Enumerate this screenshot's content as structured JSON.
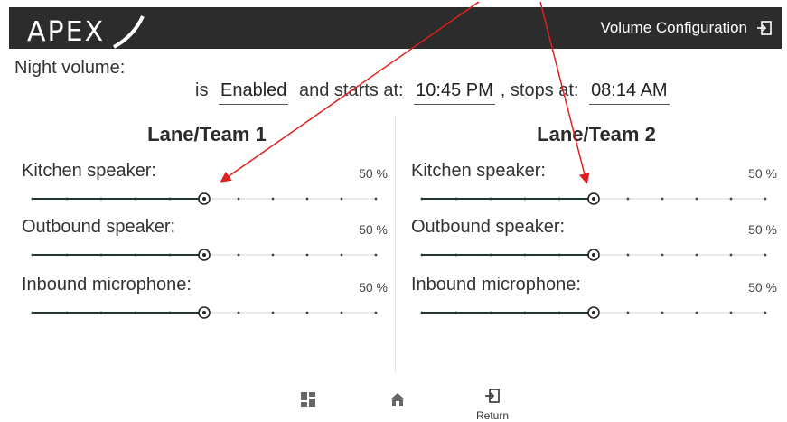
{
  "header": {
    "logo_text": "APEX",
    "title": "Volume Configuration",
    "exit_icon": "logout-icon"
  },
  "night_volume": {
    "label": "Night volume:",
    "prefix": "is",
    "state": "Enabled",
    "starts_label": "and starts at:",
    "start_time": "10:45 PM",
    "stops_label": ", stops at:",
    "stop_time": "08:14 AM"
  },
  "lanes": [
    {
      "title": "Lane/Team 1",
      "controls": [
        {
          "label": "Kitchen speaker:",
          "percent_text": "50 %",
          "value": 50
        },
        {
          "label": "Outbound speaker:",
          "percent_text": "50 %",
          "value": 50
        },
        {
          "label": "Inbound microphone:",
          "percent_text": "50 %",
          "value": 50
        }
      ]
    },
    {
      "title": "Lane/Team 2",
      "controls": [
        {
          "label": "Kitchen speaker:",
          "percent_text": "50 %",
          "value": 50
        },
        {
          "label": "Outbound speaker:",
          "percent_text": "50 %",
          "value": 50
        },
        {
          "label": "Inbound microphone:",
          "percent_text": "50 %",
          "value": 50
        }
      ]
    }
  ],
  "bottom_nav": {
    "grid_icon": "dashboard-icon",
    "home_icon": "home-icon",
    "return_icon": "return-icon",
    "return_label": "Return"
  },
  "colors": {
    "header_bg": "#2c2c2c",
    "slider_active": "#1f3a2a",
    "annotation_arrow": "#e02020"
  }
}
